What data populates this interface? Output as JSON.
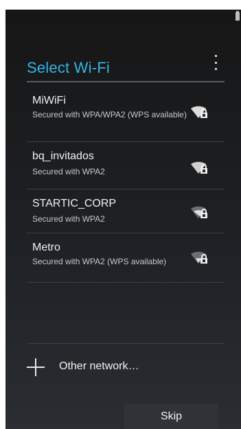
{
  "header": {
    "title": "Select Wi-Fi"
  },
  "networks": [
    {
      "name": "MiWiFi",
      "security": "Secured with WPA/WPA2 (WPS available)",
      "icon": "wifi-lock-icon"
    },
    {
      "name": "bq_invitados",
      "security": "Secured with WPA2",
      "icon": "wifi-lock-icon"
    },
    {
      "name": "STARTIC_CORP",
      "security": "Secured with WPA2",
      "icon": "wifi-lock-icon"
    },
    {
      "name": "Metro",
      "security": "Secured with WPA2 (WPS available)",
      "icon": "wifi-lock-icon"
    }
  ],
  "other": {
    "label": "Other network…"
  },
  "footer": {
    "skip_label": "Skip"
  },
  "colors": {
    "accent": "#33b5e5",
    "background": "#1f2226"
  }
}
